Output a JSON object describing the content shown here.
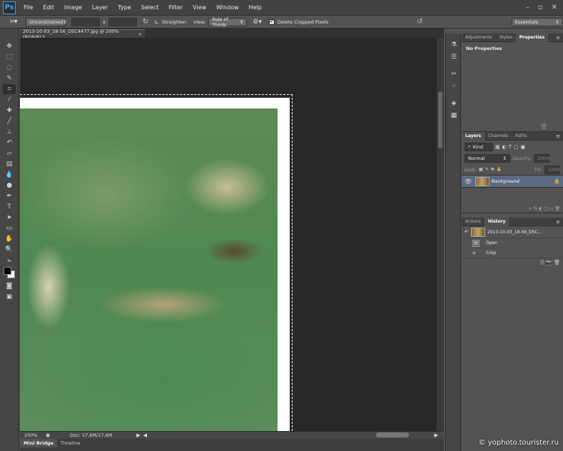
{
  "menubar": {
    "logo": "Ps",
    "items": [
      "File",
      "Edit",
      "Image",
      "Layer",
      "Type",
      "Select",
      "Filter",
      "View",
      "Window",
      "Help"
    ],
    "window_controls": [
      "–",
      "▫",
      "✕"
    ]
  },
  "options": {
    "ratio_value": "Unconstrained",
    "x_sep": "x",
    "straighten_label": "Straighten",
    "view_label": "View:",
    "view_value": "Rule of Thirds",
    "delete_cropped_label": "Delete Cropped Pixels",
    "workspace": "Essentials"
  },
  "document": {
    "tab_title": "2013-10-03_18-56_DSC4477.jpg @ 200% (RGB/8) *",
    "tab_close": "×"
  },
  "status": {
    "zoom": "200%",
    "doc_info": "Doc: 17,6M/17,6M",
    "bottom_tabs": [
      "Mini Bridge",
      "Timeline"
    ]
  },
  "panels": {
    "top_tabs": [
      "Adjustments",
      "Styles",
      "Properties"
    ],
    "properties_text": "No Properties",
    "layers_tabs": [
      "Layers",
      "Channels",
      "Paths"
    ],
    "kind_label": "Kind",
    "blend_mode": "Normal",
    "opacity_label": "Opacity:",
    "opacity_value": "100%",
    "lock_label": "Lock:",
    "fill_label": "Fill:",
    "fill_value": "100%",
    "layer_name": "Background",
    "history_tabs": [
      "Actions",
      "History"
    ],
    "history_snapshot": "2013-10-03_18-56_DSC...",
    "history_steps": [
      "Open",
      "Crop"
    ]
  },
  "watermark": "© yophoto.tourister.ru",
  "colors": {
    "accent": "#31a8ff",
    "selected_layer": "#5c6a83",
    "canvas_bg": "#282828"
  }
}
